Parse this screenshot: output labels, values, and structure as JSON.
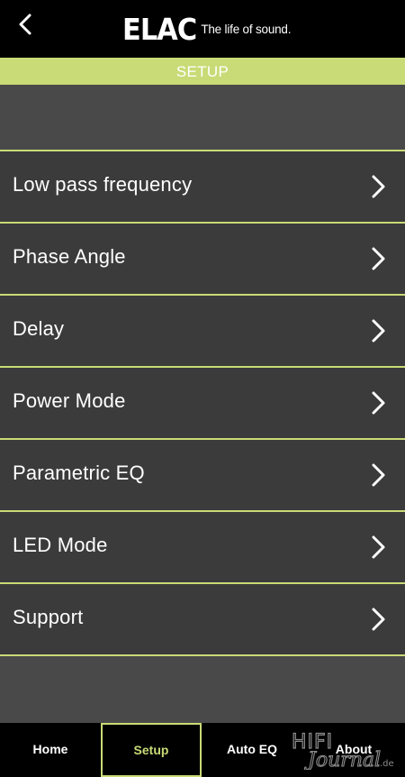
{
  "header": {
    "back_icon": "chevron-left-icon",
    "logo_mark": "ELAC",
    "logo_tagline": "The life of sound."
  },
  "setup_bar": {
    "title": "SETUP"
  },
  "menu": {
    "items": [
      {
        "label": "Low pass frequency"
      },
      {
        "label": "Phase Angle"
      },
      {
        "label": "Delay"
      },
      {
        "label": "Power Mode"
      },
      {
        "label": "Parametric EQ"
      },
      {
        "label": "LED Mode"
      },
      {
        "label": "Support"
      }
    ],
    "chevron_icon": "chevron-right-icon"
  },
  "bottom_nav": {
    "items": [
      {
        "label": "Home"
      },
      {
        "label": "Setup"
      },
      {
        "label": "Auto EQ"
      },
      {
        "label": "About"
      }
    ],
    "active": "Setup"
  },
  "watermark": {
    "text_top": "HIFI",
    "text_bottom": "Journal",
    "suffix": ".de"
  },
  "colors": {
    "accent": "#c8db76",
    "background": "#494949",
    "row": "#3b3b3b",
    "bar": "#000000"
  }
}
